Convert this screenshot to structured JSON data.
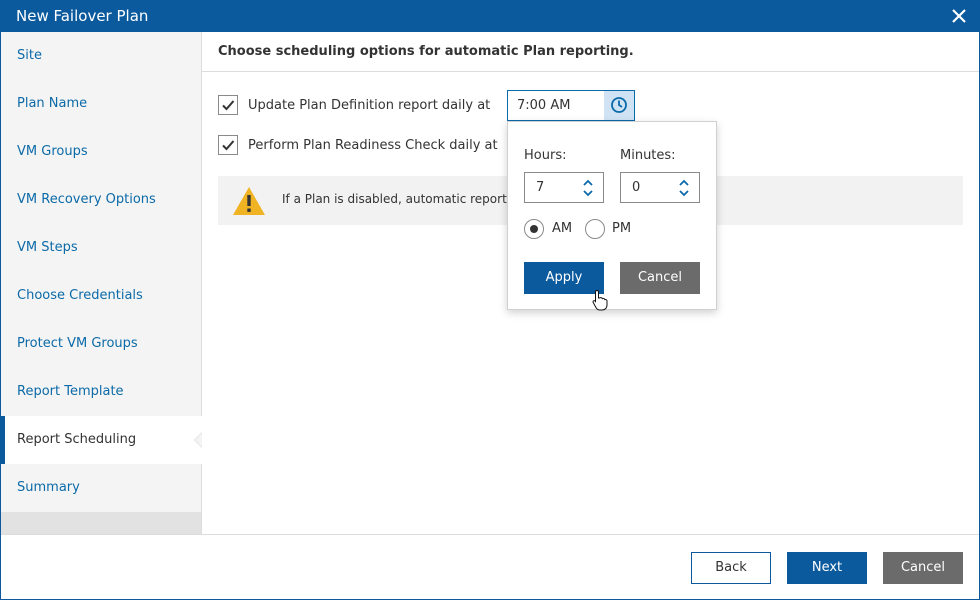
{
  "window": {
    "title": "New Failover Plan"
  },
  "sidebar": {
    "items": [
      {
        "label": "Site"
      },
      {
        "label": "Plan Name"
      },
      {
        "label": "VM Groups"
      },
      {
        "label": "VM Recovery Options"
      },
      {
        "label": "VM Steps"
      },
      {
        "label": "Choose Credentials"
      },
      {
        "label": "Protect VM Groups"
      },
      {
        "label": "Report Template"
      },
      {
        "label": "Report Scheduling",
        "active": true
      },
      {
        "label": "Summary"
      }
    ]
  },
  "main": {
    "heading": "Choose scheduling options for automatic Plan reporting.",
    "options": [
      {
        "label": "Update Plan Definition report daily at",
        "checked": true
      },
      {
        "label": "Perform Plan Readiness Check daily at",
        "checked": true
      }
    ],
    "time_value": "7:00 AM",
    "warning": "If a Plan is disabled, automatic report up"
  },
  "time_picker": {
    "hours_label": "Hours:",
    "minutes_label": "Minutes:",
    "hours_value": "7",
    "minutes_value": "0",
    "am_label": "AM",
    "pm_label": "PM",
    "selected_period": "AM",
    "apply_label": "Apply",
    "cancel_label": "Cancel"
  },
  "footer": {
    "back_label": "Back",
    "next_label": "Next",
    "cancel_label": "Cancel"
  },
  "colors": {
    "accent": "#0b5a9d",
    "link": "#0b6aa8",
    "secondary_button": "#6b6b6b",
    "clock_button_bg": "#cfe3f5",
    "warning_icon": "#f0b323"
  }
}
